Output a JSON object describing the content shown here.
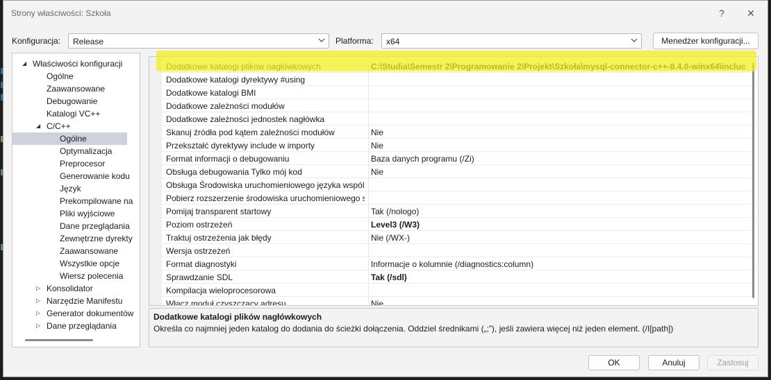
{
  "window": {
    "title": "Strony właściwości: Szkoła",
    "help_glyph": "?",
    "close_glyph": "✕"
  },
  "config": {
    "label": "Konfiguracja:",
    "value": "Release",
    "platform_label": "Platforma:",
    "platform_value": "x64",
    "manager_button": "Menedżer konfiguracji..."
  },
  "tree": [
    {
      "label": "Właściwości konfiguracji",
      "level": 0,
      "expander": "expanded",
      "selected": false
    },
    {
      "label": "Ogólne",
      "level": 1,
      "expander": "none",
      "selected": false
    },
    {
      "label": "Zaawansowane",
      "level": 1,
      "expander": "none",
      "selected": false
    },
    {
      "label": "Debugowanie",
      "level": 1,
      "expander": "none",
      "selected": false
    },
    {
      "label": "Katalogi VC++",
      "level": 1,
      "expander": "none",
      "selected": false
    },
    {
      "label": "C/C++",
      "level": 1,
      "expander": "expanded",
      "selected": false
    },
    {
      "label": "Ogólne",
      "level": 2,
      "expander": "none",
      "selected": true
    },
    {
      "label": "Optymalizacja",
      "level": 2,
      "expander": "none",
      "selected": false
    },
    {
      "label": "Preprocesor",
      "level": 2,
      "expander": "none",
      "selected": false
    },
    {
      "label": "Generowanie kodu",
      "level": 2,
      "expander": "none",
      "selected": false
    },
    {
      "label": "Język",
      "level": 2,
      "expander": "none",
      "selected": false
    },
    {
      "label": "Prekompilowane na",
      "level": 2,
      "expander": "none",
      "selected": false
    },
    {
      "label": "Pliki wyjściowe",
      "level": 2,
      "expander": "none",
      "selected": false
    },
    {
      "label": "Dane przeglądania",
      "level": 2,
      "expander": "none",
      "selected": false
    },
    {
      "label": "Zewnętrzne dyrekty",
      "level": 2,
      "expander": "none",
      "selected": false
    },
    {
      "label": "Zaawansowane",
      "level": 2,
      "expander": "none",
      "selected": false
    },
    {
      "label": "Wszystkie opcje",
      "level": 2,
      "expander": "none",
      "selected": false
    },
    {
      "label": "Wiersz polecenia",
      "level": 2,
      "expander": "none",
      "selected": false
    },
    {
      "label": "Konsolidator",
      "level": 1,
      "expander": "collapsed",
      "selected": false
    },
    {
      "label": "Narzędzie Manifestu",
      "level": 1,
      "expander": "collapsed",
      "selected": false
    },
    {
      "label": "Generator dokumentów",
      "level": 1,
      "expander": "collapsed",
      "selected": false
    },
    {
      "label": "Dane przeglądania",
      "level": 1,
      "expander": "collapsed",
      "selected": false
    }
  ],
  "properties": [
    {
      "name": "Dodatkowe katalogi plików nagłówkowych",
      "value": "C:\\Studia\\Semestr 2\\Programowanie 2\\Projekt\\Szkoła\\mysql-connector-c++-8.4.0-winx64\\incluc",
      "bold": true
    },
    {
      "name": "Dodatkowe katalogi dyrektywy #using",
      "value": "",
      "bold": false
    },
    {
      "name": "Dodatkowe katalogi BMI",
      "value": "",
      "bold": false
    },
    {
      "name": "Dodatkowe zależności modułów",
      "value": "",
      "bold": false
    },
    {
      "name": "Dodatkowe zależności jednostek nagłówka",
      "value": "",
      "bold": false
    },
    {
      "name": "Skanuj źródła pod kątem zależności modułów",
      "value": "Nie",
      "bold": false
    },
    {
      "name": "Przekształć dyrektywy include w importy",
      "value": "Nie",
      "bold": false
    },
    {
      "name": "Format informacji o debugowaniu",
      "value": "Baza danych programu (/Zi)",
      "bold": false
    },
    {
      "name": "Obsługa debugowania Tylko mój kod",
      "value": "Nie",
      "bold": false
    },
    {
      "name": "Obsługa Środowiska uruchomieniowego języka wspólnego",
      "value": "",
      "bold": false
    },
    {
      "name": "Pobierz rozszerzenie środowiska uruchomieniowego sy",
      "value": "",
      "bold": false
    },
    {
      "name": "Pomijaj transparent startowy",
      "value": "Tak (/nologo)",
      "bold": false
    },
    {
      "name": "Poziom ostrzeżeń",
      "value": "Level3 (/W3)",
      "bold": true
    },
    {
      "name": "Traktuj ostrzeżenia jak błędy",
      "value": "Nie (/WX-)",
      "bold": false
    },
    {
      "name": "Wersja ostrzeżeń",
      "value": "",
      "bold": false
    },
    {
      "name": "Format diagnostyki",
      "value": "Informacje o kolumnie (/diagnostics:column)",
      "bold": false
    },
    {
      "name": "Sprawdzanie SDL",
      "value": "Tak (/sdl)",
      "bold": true
    },
    {
      "name": "Kompilacja wieloprocesorowa",
      "value": "",
      "bold": false
    },
    {
      "name": "Włącz moduł czyszczący adresu",
      "value": "Nie",
      "bold": false
    }
  ],
  "description": {
    "title": "Dodatkowe katalogi plików nagłówkowych",
    "text": "Określa co najmniej jeden katalog do dodania do ścieżki dołączenia. Oddziel średnikami („;”), jeśli zawiera więcej niż jeden element.     (/I[path])"
  },
  "buttons": {
    "ok": "OK",
    "cancel": "Anuluj",
    "apply": "Zastosuj"
  },
  "colors": {
    "highlight": "#f2ef1e",
    "selection": "#cfd2dc"
  }
}
